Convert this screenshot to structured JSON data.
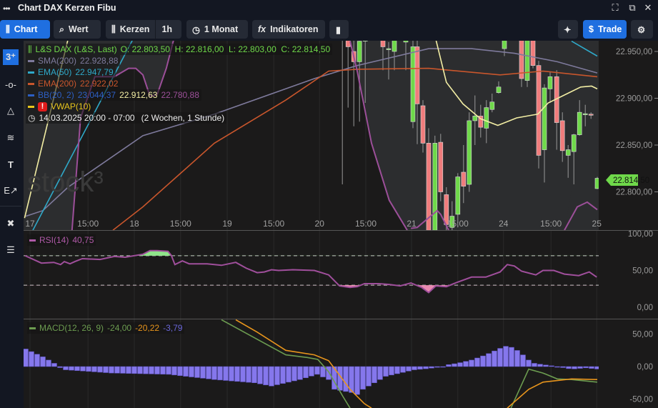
{
  "window": {
    "title": "Chart DAX Kerzen Fibu",
    "menu_icon": "more-dots-icon"
  },
  "toolbar": {
    "chart_label": "Chart",
    "wert_label": "Wert",
    "kerzen_label": "Kerzen",
    "interval_label": "1h",
    "range_label": "1 Monat",
    "indicators_label": "Indikatoren",
    "trade_label": "Trade"
  },
  "legend": {
    "instrument": "L&S DAX (L&S, Last)",
    "ohlc": "O: 22.803,50  H: 22.816,00  L: 22.803,00  C: 22.814,50",
    "sma_label": "SMA(200)",
    "sma_value": "22.928,88",
    "ema50_label": "EMA(50)",
    "ema50_value": "22.947,79",
    "ema200_label": "EMA(200)",
    "ema200_value": "22.922,02",
    "bb_label": "BB(20, 2)",
    "bb_upper": "23.044,37",
    "bb_mid": "22.912,63",
    "bb_lower": "22.780,88",
    "vwap_label": "VWAP(10)",
    "period": "14.03.2025 20:00 - 07:00",
    "period_note": "(2 Wochen, 1 Stunde)",
    "rsi_label": "RSI(14)",
    "rsi_value": "40,75",
    "macd_label": "MACD(12, 26, 9)",
    "macd_value": "-24,00",
    "macd_signal": "-20,22",
    "macd_hist": "-3,79"
  },
  "colors": {
    "green": "#6fd94a",
    "red": "#f07c7c",
    "sma": "#7e7a9c",
    "ema50": "#2fa9c9",
    "ema200": "#c9562c",
    "bb": "#9c4f99",
    "vwap": "#f3eea4",
    "macd": "#6c9c50",
    "signal": "#e8951c",
    "hist": "#8577ec",
    "accent": "#1f6fe0"
  },
  "chart_data": {
    "type": "candlestick",
    "price_axis": {
      "ticks": [
        "22.950,00",
        "22.900,00",
        "22.850,00",
        "22.800,00"
      ],
      "tick_values": [
        22950,
        22900,
        22850,
        22800
      ],
      "last_price": "22.814,50"
    },
    "x_ticks": [
      {
        "bar": 0.75,
        "label": "17"
      },
      {
        "bar": 10.9,
        "label": "15:00"
      },
      {
        "bar": 19,
        "label": "18"
      },
      {
        "bar": 27.1,
        "label": "15:00"
      },
      {
        "bar": 35.25,
        "label": "19"
      },
      {
        "bar": 43.4,
        "label": "15:00"
      },
      {
        "bar": 51.4,
        "label": "20"
      },
      {
        "bar": 59.5,
        "label": "15:00"
      },
      {
        "bar": 67.5,
        "label": "21"
      },
      {
        "bar": 75.6,
        "label": "15:00"
      },
      {
        "bar": 83.6,
        "label": "24"
      },
      {
        "bar": 91.9,
        "label": "15:00"
      },
      {
        "bar": 99.9,
        "label": "25"
      }
    ],
    "candles": [
      [
        55.4,
        22975,
        22980,
        22808,
        22966
      ],
      [
        56.4,
        22968,
        22980,
        22890,
        22955
      ],
      [
        57.4,
        22950,
        22970,
        22870,
        22939
      ],
      [
        58.4,
        22939,
        22970,
        22875,
        22961
      ],
      [
        59.4,
        22961,
        22970,
        22895,
        22964
      ],
      [
        62.5,
        22970,
        22980,
        22930,
        22955
      ],
      [
        63.5,
        22952,
        22960,
        22920,
        22953
      ],
      [
        64.5,
        22950,
        22975,
        22930,
        22966
      ],
      [
        66.5,
        22960,
        22975,
        22930,
        22964
      ],
      [
        67.75,
        22875,
        22963,
        22868,
        22955
      ],
      [
        68.5,
        22955,
        22963,
        22851,
        22894
      ],
      [
        69.5,
        22892,
        22898,
        22842,
        22852
      ],
      [
        70.5,
        22852,
        22868,
        22750,
        22759
      ],
      [
        71.6,
        22759,
        22860,
        22750,
        22852
      ],
      [
        72.6,
        22853,
        22862,
        22790,
        22800
      ],
      [
        73.6,
        22797,
        22805,
        22757,
        22765
      ],
      [
        74.6,
        22762,
        22790,
        22755,
        22774
      ],
      [
        75.6,
        22776,
        22820,
        22762,
        22816
      ],
      [
        76.6,
        22821,
        22850,
        22788,
        22806
      ],
      [
        77.6,
        22808,
        22885,
        22800,
        22876
      ],
      [
        78.6,
        22876,
        22903,
        22850,
        22881
      ],
      [
        79.6,
        22881,
        22893,
        22858,
        22869
      ],
      [
        80.6,
        22868,
        22898,
        22852,
        22890
      ],
      [
        81.6,
        22888,
        22905,
        22885,
        22896
      ],
      [
        82.75,
        22906,
        22918,
        22905,
        22912
      ],
      [
        83.75,
        22953,
        22968,
        22945,
        22963
      ],
      [
        86.75,
        22963,
        22968,
        22912,
        22921
      ],
      [
        87.75,
        22919,
        22968,
        22912,
        22963
      ],
      [
        88.75,
        22963,
        22968,
        22932,
        22935
      ],
      [
        89.75,
        22935,
        22940,
        22825,
        22839
      ],
      [
        90.75,
        22845,
        22915,
        22810,
        22911
      ],
      [
        91.75,
        22910,
        22928,
        22895,
        22923
      ],
      [
        92.9,
        22923,
        22930,
        22845,
        22874
      ],
      [
        93.9,
        22876,
        22885,
        22832,
        22844
      ],
      [
        94.9,
        22839,
        22850,
        22815,
        22845
      ],
      [
        95.9,
        22843,
        22862,
        22808,
        22861
      ],
      [
        96.9,
        22861,
        22898,
        22860,
        22885
      ],
      [
        97.9,
        22883,
        22893,
        22870,
        22883.5
      ],
      [
        98.9,
        22883,
        22885,
        22878,
        22882
      ],
      [
        100,
        22803.5,
        22816,
        22803,
        22814.5
      ]
    ],
    "sma200": [
      [
        [
          0,
          22774
        ],
        [
          3,
          22780
        ],
        [
          7.4,
          22805
        ],
        [
          20.5,
          22860
        ],
        [
          33,
          22883
        ],
        [
          50.5,
          22921
        ],
        [
          58,
          22935
        ],
        [
          70.5,
          22953
        ],
        [
          78,
          22953
        ],
        [
          85.5,
          22948
        ],
        [
          93,
          22939
        ],
        [
          100,
          22927
        ]
      ]
    ],
    "ema50": [
      [
        [
          1.25,
          22759
        ],
        [
          18.75,
          22963
        ]
      ],
      [
        [
          95.5,
          22961
        ],
        [
          100,
          22945
        ]
      ]
    ],
    "ema200": [
      [
        [
          15.25,
          22759
        ],
        [
          20.5,
          22784
        ],
        [
          33,
          22852
        ],
        [
          45.5,
          22898
        ],
        [
          53,
          22929
        ],
        [
          58,
          22931
        ],
        [
          70.5,
          22932
        ],
        [
          83,
          22925
        ],
        [
          90.5,
          22929
        ],
        [
          100,
          22923
        ]
      ]
    ],
    "bb_lower": [
      [
        [
          8.1,
          22759
        ],
        [
          9.6,
          22879
        ],
        [
          12.1,
          22923
        ],
        [
          15.5,
          22923
        ],
        [
          18,
          22932
        ],
        [
          19.25,
          22932
        ],
        [
          20.5,
          22925
        ],
        [
          21.75,
          22902
        ],
        [
          23,
          22904
        ],
        [
          24.6,
          22932
        ],
        [
          25.9,
          22963
        ]
      ],
      [
        [
          56.75,
          22961
        ],
        [
          58,
          22929
        ],
        [
          60.5,
          22852
        ],
        [
          63.6,
          22791
        ],
        [
          66.75,
          22759
        ]
      ],
      [
        [
          67.4,
          22761
        ],
        [
          68.5,
          22762
        ],
        [
          72,
          22780
        ],
        [
          72.6,
          22776
        ],
        [
          74,
          22759
        ]
      ],
      [
        [
          94.25,
          22759
        ],
        [
          96.5,
          22784
        ],
        [
          98.25,
          22789
        ],
        [
          100,
          22781
        ]
      ]
    ],
    "vwap": [
      [
        [
          -0.2,
          22772
        ],
        [
          7.4,
          22963
        ]
      ],
      [
        [
          71.75,
          22963
        ],
        [
          73.6,
          22917
        ],
        [
          76.5,
          22894
        ],
        [
          79.6,
          22878
        ],
        [
          82.6,
          22871
        ],
        [
          85.9,
          22879
        ],
        [
          88.6,
          22882
        ],
        [
          89.6,
          22883
        ],
        [
          91.4,
          22895
        ],
        [
          95.1,
          22906
        ],
        [
          97.1,
          22912
        ],
        [
          99,
          22913
        ],
        [
          100,
          22910
        ]
      ]
    ],
    "rsi": {
      "axis_ticks": [
        "100,00",
        "50,00",
        "0,00"
      ],
      "tick_values": [
        100,
        50,
        0
      ],
      "levels": [
        70,
        30
      ],
      "points": [
        [
          -0.1,
          70
        ],
        [
          2.75,
          60
        ],
        [
          4.9,
          61
        ],
        [
          6.1,
          58
        ],
        [
          6.75,
          62
        ],
        [
          7.75,
          59
        ],
        [
          8.6,
          62
        ],
        [
          9.9,
          66
        ],
        [
          13,
          65
        ],
        [
          15.5,
          69
        ],
        [
          17.4,
          68
        ],
        [
          20.5,
          72
        ],
        [
          21.75,
          77
        ],
        [
          23,
          77
        ],
        [
          24.9,
          76
        ],
        [
          25.5,
          70
        ],
        [
          26.1,
          58
        ],
        [
          27.4,
          63
        ],
        [
          28.6,
          59
        ],
        [
          31.75,
          59
        ],
        [
          34.25,
          57
        ],
        [
          36.75,
          61
        ],
        [
          38.6,
          53
        ],
        [
          40.5,
          47
        ],
        [
          41.75,
          48
        ],
        [
          43,
          51
        ],
        [
          44.25,
          50
        ],
        [
          46.75,
          51
        ],
        [
          50.5,
          50
        ],
        [
          53,
          44
        ],
        [
          54.9,
          29
        ],
        [
          56.75,
          27
        ],
        [
          58,
          28
        ],
        [
          59.25,
          32
        ],
        [
          61.75,
          32
        ],
        [
          63.6,
          31
        ],
        [
          65.5,
          29
        ],
        [
          67.4,
          33
        ],
        [
          69.25,
          27
        ],
        [
          70.5,
          20
        ],
        [
          71.75,
          29
        ],
        [
          73.6,
          28
        ],
        [
          75.5,
          34
        ],
        [
          78,
          41
        ],
        [
          80.5,
          41
        ],
        [
          83,
          48
        ],
        [
          84.25,
          58
        ],
        [
          85.5,
          56
        ],
        [
          86.75,
          49
        ],
        [
          89.25,
          44
        ],
        [
          90.5,
          50
        ],
        [
          92.4,
          50
        ],
        [
          94.25,
          45
        ],
        [
          96.75,
          43
        ],
        [
          98.6,
          48
        ],
        [
          99.9,
          41
        ]
      ]
    },
    "macd": {
      "axis_ticks": [
        "50,00",
        "0,00",
        "-50,00"
      ],
      "tick_values": [
        50,
        0,
        -50
      ],
      "histogram": [
        [
          0,
          27
        ],
        [
          1,
          23
        ],
        [
          3,
          15
        ],
        [
          5,
          5
        ],
        [
          5.5,
          0
        ],
        [
          7,
          -5
        ],
        [
          15,
          -10
        ],
        [
          25,
          -12
        ],
        [
          33,
          -20
        ],
        [
          40,
          -25
        ],
        [
          43,
          -30
        ],
        [
          48,
          -20
        ],
        [
          51,
          -12
        ],
        [
          53,
          -20
        ],
        [
          54,
          -35
        ],
        [
          57,
          -40
        ],
        [
          58,
          -43
        ],
        [
          59,
          -35
        ],
        [
          61,
          -25
        ],
        [
          63,
          -15
        ],
        [
          65.5,
          -10
        ],
        [
          68,
          -5
        ],
        [
          70.5,
          -3
        ],
        [
          73,
          0
        ],
        [
          74,
          3
        ],
        [
          75.5,
          5
        ],
        [
          78,
          10
        ],
        [
          80.5,
          18
        ],
        [
          83,
          28
        ],
        [
          84.25,
          32
        ],
        [
          85.5,
          28
        ],
        [
          86.75,
          20
        ],
        [
          88,
          10
        ],
        [
          89,
          5
        ],
        [
          90.5,
          3
        ],
        [
          93,
          0
        ],
        [
          95.5,
          -4
        ],
        [
          98,
          -2
        ],
        [
          100,
          -3.79
        ]
      ],
      "macd_line": [
        [
          [
            34.25,
            72
          ],
          [
            40.5,
            42
          ],
          [
            45.5,
            18
          ],
          [
            49.25,
            14
          ],
          [
            51.1,
            11
          ],
          [
            53,
            -8
          ],
          [
            55.5,
            -46
          ],
          [
            56.75,
            -64
          ]
        ],
        [
          [
            84.9,
            -64
          ],
          [
            88,
            -4
          ],
          [
            90.5,
            -10
          ],
          [
            93,
            -19
          ],
          [
            95.5,
            -20
          ],
          [
            100,
            -24
          ]
        ]
      ],
      "signal_line": [
        [
          [
            36.75,
            72
          ],
          [
            40.5,
            53
          ],
          [
            45.5,
            25
          ],
          [
            50.5,
            18
          ],
          [
            53,
            9
          ],
          [
            56.75,
            -35
          ],
          [
            59.25,
            -57
          ],
          [
            60.5,
            -64
          ]
        ],
        [
          [
            84.25,
            -64
          ],
          [
            88,
            -35
          ],
          [
            90.5,
            -24
          ],
          [
            95.5,
            -19
          ],
          [
            100,
            -20
          ]
        ]
      ]
    }
  }
}
